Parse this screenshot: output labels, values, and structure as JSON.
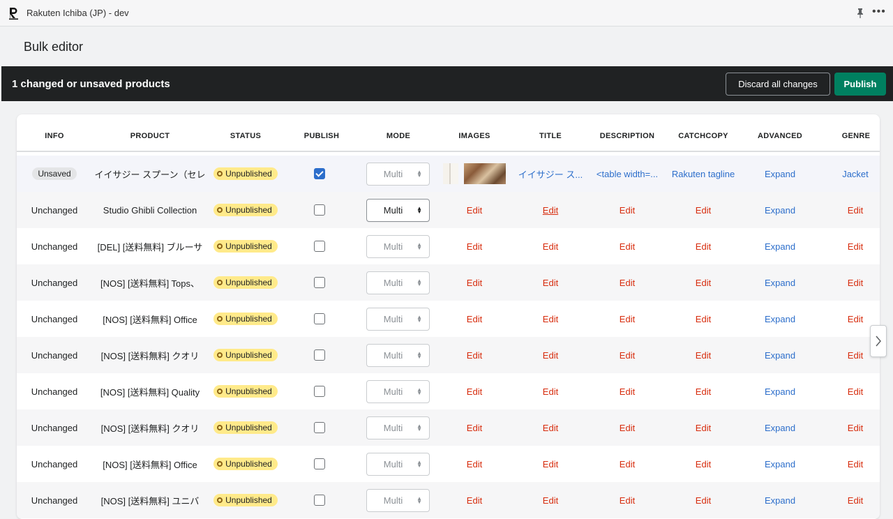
{
  "window": {
    "title": "Rakuten Ichiba (JP) - dev"
  },
  "page": {
    "title": "Bulk editor"
  },
  "banner": {
    "text": "1 changed or unsaved products",
    "discard_label": "Discard all changes",
    "publish_label": "Publish"
  },
  "columns": [
    "INFO",
    "PRODUCT",
    "STATUS",
    "PUBLISH",
    "MODE",
    "IMAGES",
    "TITLE",
    "DESCRIPTION",
    "CATCHCOPY",
    "ADVANCED",
    "GENRE"
  ],
  "rows": [
    {
      "info": "Unsaved",
      "product": "イイサジー スプーン（セレ",
      "status": "Unpublished",
      "published": true,
      "mode": "Multi",
      "title": "イイサジー ス...",
      "description": "<table width=...",
      "catchcopy": "Rakuten tagline",
      "advanced": "Expand",
      "genre": "Jacket"
    },
    {
      "info": "Unchanged",
      "product": "Studio Ghibli Collection",
      "status": "Unpublished",
      "published": false,
      "mode": "Multi",
      "images": "Edit",
      "title": "Edit",
      "description": "Edit",
      "catchcopy": "Edit",
      "advanced": "Expand",
      "genre": "Edit"
    },
    {
      "info": "Unchanged",
      "product": "[DEL] [送料無料] ブルーサ",
      "status": "Unpublished",
      "published": false,
      "mode": "Multi",
      "images": "Edit",
      "title": "Edit",
      "description": "Edit",
      "catchcopy": "Edit",
      "advanced": "Expand",
      "genre": "Edit"
    },
    {
      "info": "Unchanged",
      "product": "[NOS] [送料無料] Tops、",
      "status": "Unpublished",
      "published": false,
      "mode": "Multi",
      "images": "Edit",
      "title": "Edit",
      "description": "Edit",
      "catchcopy": "Edit",
      "advanced": "Expand",
      "genre": "Edit"
    },
    {
      "info": "Unchanged",
      "product": "[NOS] [送料無料] Office",
      "status": "Unpublished",
      "published": false,
      "mode": "Multi",
      "images": "Edit",
      "title": "Edit",
      "description": "Edit",
      "catchcopy": "Edit",
      "advanced": "Expand",
      "genre": "Edit"
    },
    {
      "info": "Unchanged",
      "product": "[NOS] [送料無料] クオリ",
      "status": "Unpublished",
      "published": false,
      "mode": "Multi",
      "images": "Edit",
      "title": "Edit",
      "description": "Edit",
      "catchcopy": "Edit",
      "advanced": "Expand",
      "genre": "Edit"
    },
    {
      "info": "Unchanged",
      "product": "[NOS] [送料無料] Quality",
      "status": "Unpublished",
      "published": false,
      "mode": "Multi",
      "images": "Edit",
      "title": "Edit",
      "description": "Edit",
      "catchcopy": "Edit",
      "advanced": "Expand",
      "genre": "Edit"
    },
    {
      "info": "Unchanged",
      "product": "[NOS] [送料無料] クオリ",
      "status": "Unpublished",
      "published": false,
      "mode": "Multi",
      "images": "Edit",
      "title": "Edit",
      "description": "Edit",
      "catchcopy": "Edit",
      "advanced": "Expand",
      "genre": "Edit"
    },
    {
      "info": "Unchanged",
      "product": "[NOS] [送料無料] Office",
      "status": "Unpublished",
      "published": false,
      "mode": "Multi",
      "images": "Edit",
      "title": "Edit",
      "description": "Edit",
      "catchcopy": "Edit",
      "advanced": "Expand",
      "genre": "Edit"
    },
    {
      "info": "Unchanged",
      "product": "[NOS] [送料無料] ユニバ",
      "status": "Unpublished",
      "published": false,
      "mode": "Multi",
      "images": "Edit",
      "title": "Edit",
      "description": "Edit",
      "catchcopy": "Edit",
      "advanced": "Expand",
      "genre": "Edit"
    }
  ],
  "icons": {
    "logo": "rakuten-r-logo",
    "pin": "pin-icon",
    "more": "more-horizontal-icon",
    "scroll": "chevron-right-icon"
  },
  "colors": {
    "publish_button": "#008060",
    "banner_bg": "#202223",
    "edit_link": "#d72c0d",
    "blue_link": "#2c6ecb",
    "status_badge": "#ffea8a"
  }
}
